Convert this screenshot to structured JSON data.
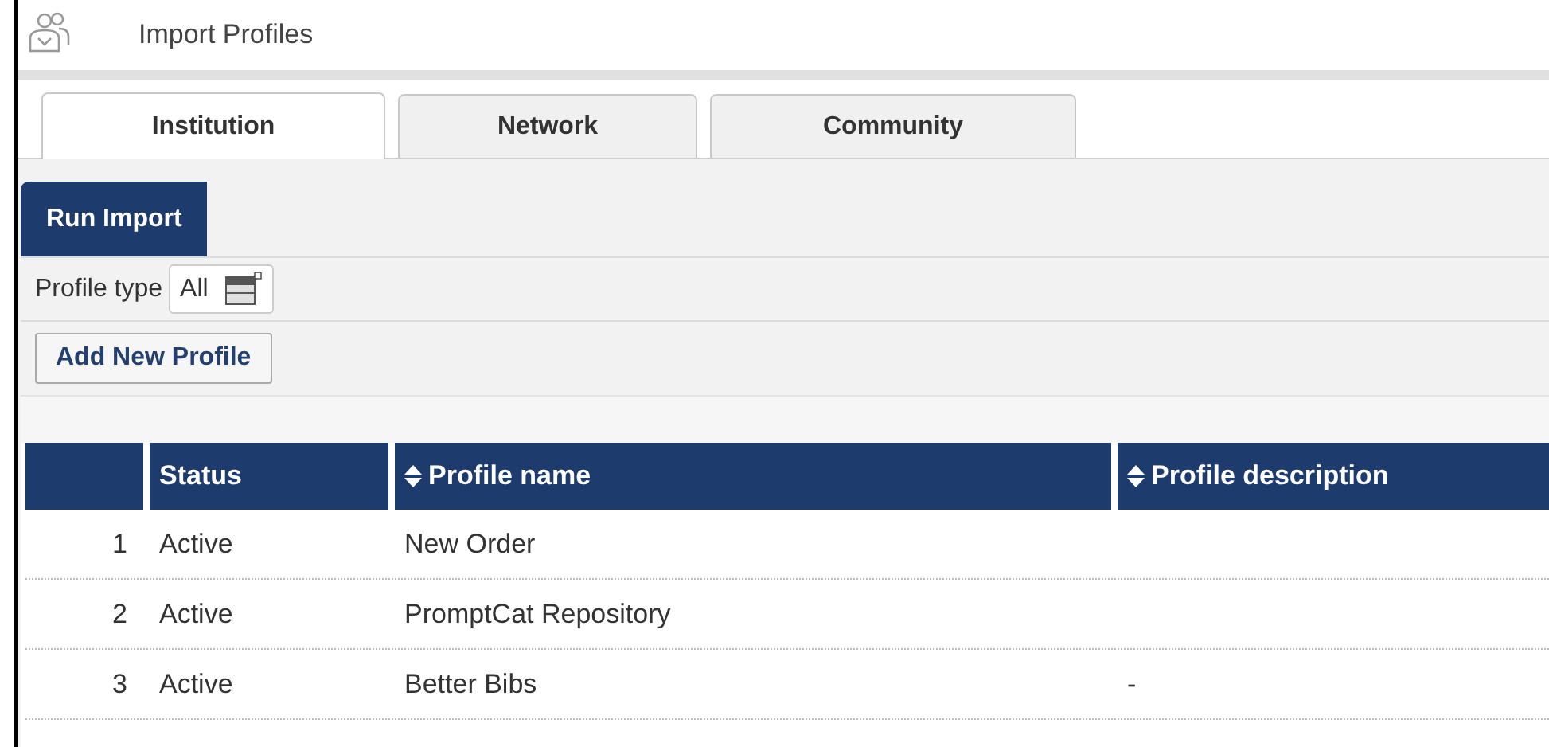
{
  "page": {
    "title": "Import Profiles"
  },
  "tabs": [
    {
      "label": "Institution",
      "selected": true
    },
    {
      "label": "Network",
      "selected": false
    },
    {
      "label": "Community",
      "selected": false
    }
  ],
  "actions": {
    "run_button": "Run Import",
    "filter_label": "Profile type",
    "filter_value": "All",
    "add_button": "Add New Profile"
  },
  "table": {
    "columns": [
      {
        "label": "Status",
        "sortable": false
      },
      {
        "label": "Profile name",
        "sortable": true
      },
      {
        "label": "Profile description",
        "sortable": true
      }
    ],
    "rows": [
      {
        "index": "1",
        "status": "Active",
        "name": "New Order"
      },
      {
        "index": "2",
        "status": "Active",
        "name": "PromptCat Repository"
      },
      {
        "index": "3",
        "status": "Active",
        "name": "Better Bibs",
        "description": "-"
      }
    ]
  }
}
